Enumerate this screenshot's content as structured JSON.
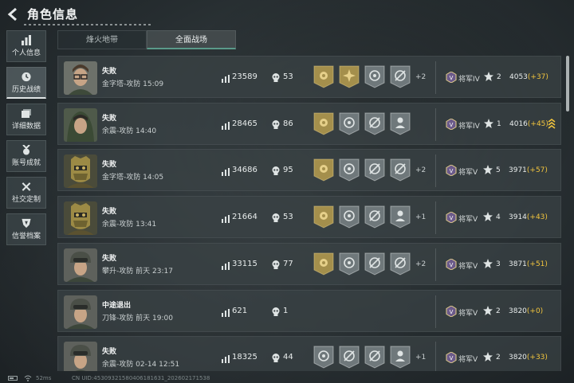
{
  "header": {
    "title": "角色信息"
  },
  "sidebar": {
    "items": [
      {
        "label": "个人信息",
        "icon": "bar-chart-icon",
        "active": false
      },
      {
        "label": "历史战绩",
        "icon": "history-clock-icon",
        "active": true
      },
      {
        "label": "详细数据",
        "icon": "folder-icon",
        "active": false
      },
      {
        "label": "账号成就",
        "icon": "medal-icon",
        "active": false
      },
      {
        "label": "社交定制",
        "icon": "tools-icon",
        "active": false
      },
      {
        "label": "信誉档案",
        "icon": "shield-icon",
        "active": false
      }
    ]
  },
  "tabs": [
    {
      "label": "烽火地带",
      "active": false
    },
    {
      "label": "全面战场",
      "active": true
    }
  ],
  "matches": [
    {
      "result": "失败",
      "map": "金字塔-攻防",
      "time": "15:09",
      "score": "23589",
      "kills": "53",
      "badges": [
        "gold-flower",
        "gold-burst",
        "silver-target",
        "silver-slash"
      ],
      "extra": "+2",
      "rank": "将军IV",
      "stars": "2",
      "points": "4053",
      "delta": "(+37)",
      "avatar": "glasses"
    },
    {
      "result": "失败",
      "map": "余震-攻防",
      "time": "14:40",
      "score": "28465",
      "kills": "86",
      "badges": [
        "gold-flower",
        "silver-target",
        "silver-slash",
        "silver-soldier"
      ],
      "extra": "",
      "rank": "将军IV",
      "stars": "1",
      "points": "4016",
      "delta": "(+45)",
      "avatar": "hood",
      "promote": true
    },
    {
      "result": "失败",
      "map": "金字塔-攻防",
      "time": "14:05",
      "score": "34686",
      "kills": "95",
      "badges": [
        "gold-flower",
        "silver-target",
        "silver-slash",
        "silver-slash"
      ],
      "extra": "+2",
      "rank": "将军V",
      "stars": "5",
      "points": "3971",
      "delta": "(+57)",
      "avatar": "gold"
    },
    {
      "result": "失败",
      "map": "余震-攻防",
      "time": "13:41",
      "score": "21664",
      "kills": "53",
      "badges": [
        "gold-flower",
        "silver-target",
        "silver-slash",
        "silver-soldier"
      ],
      "extra": "+1",
      "rank": "将军V",
      "stars": "4",
      "points": "3914",
      "delta": "(+43)",
      "avatar": "gold"
    },
    {
      "result": "失败",
      "map": "攀升-攻防",
      "time": "前天 23:17",
      "score": "33115",
      "kills": "77",
      "badges": [
        "gold-flower",
        "silver-target",
        "silver-slash",
        "silver-slash"
      ],
      "extra": "+2",
      "rank": "将军V",
      "stars": "3",
      "points": "3871",
      "delta": "(+51)",
      "avatar": "helmet"
    },
    {
      "result": "中途退出",
      "map": "刀锋-攻防",
      "time": "前天 19:00",
      "score": "621",
      "kills": "1",
      "badges": [],
      "extra": "",
      "rank": "将军V",
      "stars": "2",
      "points": "3820",
      "delta": "(+0)",
      "avatar": "helmet"
    },
    {
      "result": "失败",
      "map": "余震-攻防",
      "time": "02-14 12:51",
      "score": "18325",
      "kills": "44",
      "badges": [
        "silver-target",
        "silver-slash",
        "silver-slash",
        "silver-soldier"
      ],
      "extra": "+1",
      "rank": "将军V",
      "stars": "2",
      "points": "3820",
      "delta": "(+33)",
      "avatar": "helmet"
    }
  ],
  "footer": {
    "ping": "52ms",
    "uid": "CN UID:453093215804061816​31_202602171538"
  },
  "colors": {
    "gold": "#b9a25c",
    "silver": "#7b8386",
    "delta": "#f2c53d",
    "accent": "#5a9a8a"
  }
}
